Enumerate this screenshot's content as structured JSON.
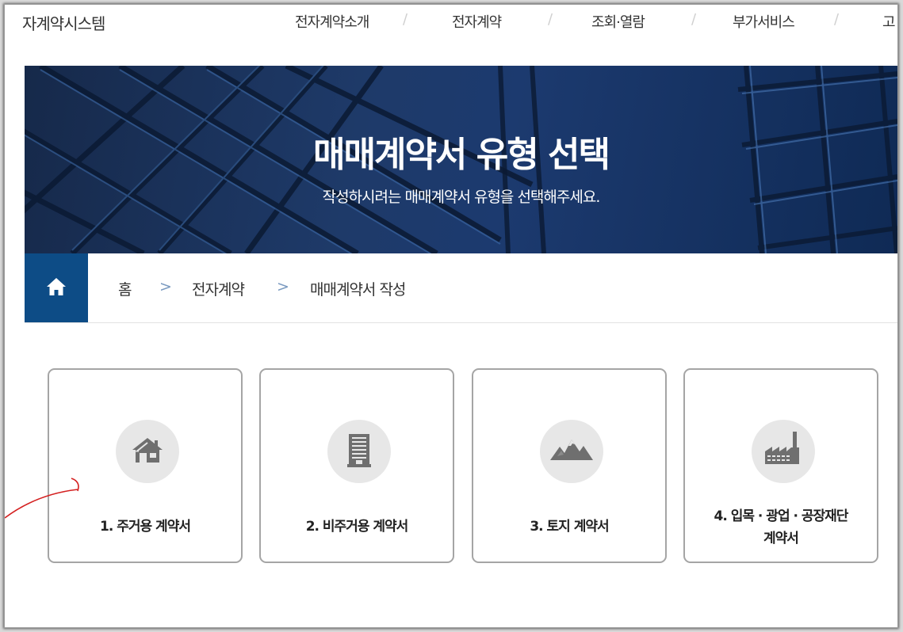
{
  "header": {
    "site_title": "자계약시스템",
    "nav": [
      "전자계약소개",
      "전자계약",
      "조회·열람",
      "부가서비스",
      "고"
    ],
    "separator": "/"
  },
  "banner": {
    "title": "매매계약서 유형 선택",
    "subtitle": "작성하시려는 매매계약서 유형을 선택해주세요."
  },
  "breadcrumb": {
    "home_icon": "home-icon",
    "items": [
      "홈",
      "전자계약",
      "매매계약서 작성"
    ],
    "separator": ">"
  },
  "cards": [
    {
      "label": "1. 주거용 계약서",
      "icon": "house-icon"
    },
    {
      "label": "2. 비주거용 계약서",
      "icon": "building-icon"
    },
    {
      "label": "3. 토지 계약서",
      "icon": "mountain-icon"
    },
    {
      "label_line1": "4. 입목 · 광업 · 공장재단",
      "label_line2": "계약서",
      "icon": "factory-icon"
    }
  ],
  "colors": {
    "accent": "#0d4c86",
    "banner": "#1e3a69",
    "icon_bg": "#e7e7e7",
    "icon_fg": "#6f6f6f"
  }
}
